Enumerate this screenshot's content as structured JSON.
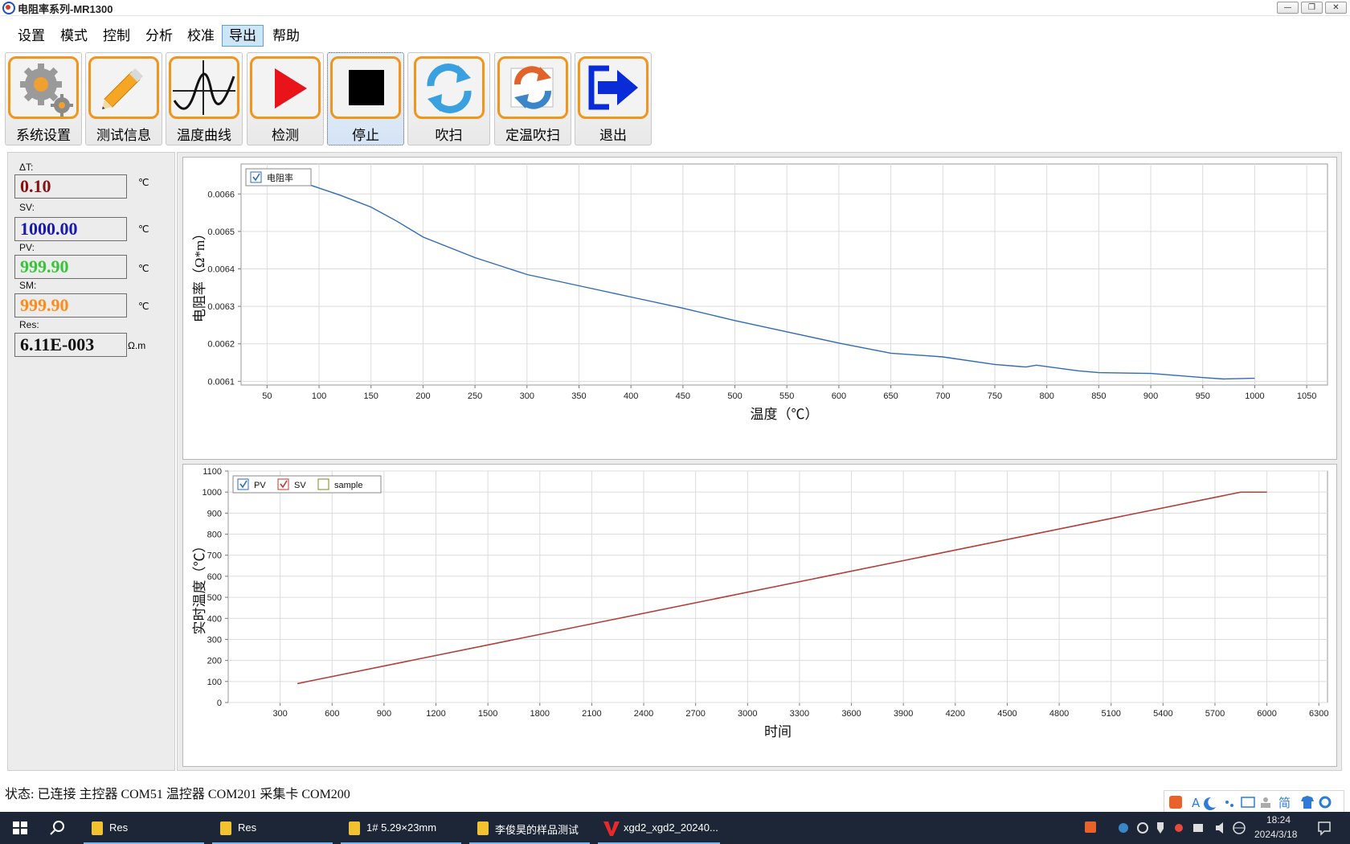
{
  "window": {
    "title": "电阻率系列-MR1300",
    "minimize": "—",
    "restore": "❐",
    "close": "✕"
  },
  "menu": [
    {
      "id": "settings",
      "label": "设置"
    },
    {
      "id": "mode",
      "label": "模式"
    },
    {
      "id": "control",
      "label": "控制"
    },
    {
      "id": "analysis",
      "label": "分析"
    },
    {
      "id": "calibrate",
      "label": "校准"
    },
    {
      "id": "export",
      "label": "导出",
      "active": true
    },
    {
      "id": "help",
      "label": "帮助"
    }
  ],
  "toolbar": [
    {
      "id": "system-settings",
      "label": "系统设置",
      "icon": "gears-icon"
    },
    {
      "id": "test-info",
      "label": "测试信息",
      "icon": "pencil-icon"
    },
    {
      "id": "temperature-curve",
      "label": "温度曲线",
      "icon": "curve-icon"
    },
    {
      "id": "detect",
      "label": "检测",
      "icon": "play-icon"
    },
    {
      "id": "stop",
      "label": "停止",
      "icon": "stop-icon",
      "selected": true
    },
    {
      "id": "sweep",
      "label": "吹扫",
      "icon": "refresh-icon"
    },
    {
      "id": "fixed-temp-sweep",
      "label": "定温吹扫",
      "icon": "cycle-icon"
    },
    {
      "id": "exit",
      "label": "退出",
      "icon": "exit-icon"
    }
  ],
  "readouts": [
    {
      "id": "delta-t",
      "label": "ΔT:",
      "value": "0.10",
      "unit": "℃",
      "color": "#8b1010"
    },
    {
      "id": "sv",
      "label": "SV:",
      "value": "1000.00",
      "unit": "℃",
      "color": "#1a1ab0"
    },
    {
      "id": "pv",
      "label": "PV:",
      "value": "999.90",
      "unit": "℃",
      "color": "#39c439"
    },
    {
      "id": "sm",
      "label": "SM:",
      "value": "999.90",
      "unit": "℃",
      "color": "#ff8c1a"
    },
    {
      "id": "res",
      "label": "Res:",
      "value": "6.11E-003",
      "unit": "Ω.m",
      "color": "#111111"
    }
  ],
  "chart_data": [
    {
      "type": "line",
      "xlabel": "温度（℃）",
      "ylabel": "电阻率（Ω*m）",
      "xlim": [
        25,
        1070
      ],
      "ylim": [
        0.00609,
        0.00668
      ],
      "xticks": [
        "50",
        "100",
        "150",
        "200",
        "250",
        "300",
        "350",
        "400",
        "450",
        "500",
        "550",
        "600",
        "650",
        "700",
        "750",
        "800",
        "850",
        "900",
        "950",
        "1000",
        "1050"
      ],
      "yticks": [
        "0.0061",
        "0.0062",
        "0.0063",
        "0.0064",
        "0.0065",
        "0.0066"
      ],
      "grid": true,
      "legend_position": "top-left",
      "series": [
        {
          "name": "电阻率",
          "color": "#2e6bb8",
          "checked": true,
          "points": [
            [
              90,
              0.006625
            ],
            [
              120,
              0.006597
            ],
            [
              150,
              0.006565
            ],
            [
              175,
              0.006527
            ],
            [
              200,
              0.006485
            ],
            [
              250,
              0.00643
            ],
            [
              300,
              0.006385
            ],
            [
              350,
              0.006355
            ],
            [
              400,
              0.006325
            ],
            [
              450,
              0.006295
            ],
            [
              500,
              0.006262
            ],
            [
              550,
              0.006232
            ],
            [
              600,
              0.006202
            ],
            [
              650,
              0.006175
            ],
            [
              700,
              0.006165
            ],
            [
              750,
              0.006145
            ],
            [
              780,
              0.006138
            ],
            [
              790,
              0.006143
            ],
            [
              830,
              0.006128
            ],
            [
              850,
              0.006123
            ],
            [
              900,
              0.006121
            ],
            [
              950,
              0.00611
            ],
            [
              970,
              0.006106
            ],
            [
              1000,
              0.006108
            ]
          ]
        }
      ]
    },
    {
      "type": "line",
      "xlabel": "时间",
      "ylabel": "实时温度（℃）",
      "xlim": [
        0,
        6350
      ],
      "ylim": [
        0,
        1100
      ],
      "xticks": [
        "300",
        "600",
        "900",
        "1200",
        "1500",
        "1800",
        "2100",
        "2400",
        "2700",
        "3000",
        "3300",
        "3600",
        "3900",
        "4200",
        "4500",
        "4800",
        "5100",
        "5400",
        "5700",
        "6000",
        "6300"
      ],
      "yticks": [
        "0",
        "100",
        "200",
        "300",
        "400",
        "500",
        "600",
        "700",
        "800",
        "900",
        "1000",
        "1100"
      ],
      "grid": true,
      "legend_position": "top-left",
      "series": [
        {
          "name": "PV",
          "color": "#2e6bb8",
          "checked": true,
          "points": [
            [
              400,
              90
            ],
            [
              5850,
              1000
            ],
            [
              6000,
              1000
            ]
          ]
        },
        {
          "name": "SV",
          "color": "#c0392b",
          "checked": true,
          "points": [
            [
              400,
              90
            ],
            [
              5850,
              1000
            ],
            [
              6000,
              1000
            ]
          ]
        },
        {
          "name": "sample",
          "color": "#7a8a20",
          "checked": false,
          "points": []
        }
      ]
    }
  ],
  "status": {
    "text": "状态:  已连接   主控器 COM51 温控器 COM201 采集卡 COM200"
  },
  "taskbar": {
    "items": [
      {
        "label": "Res"
      },
      {
        "label": "Res"
      },
      {
        "label": "1# 5.29×23mm"
      },
      {
        "label": "李俊昊的样品测试"
      },
      {
        "label": "xgd2_xgd2_20240..."
      }
    ],
    "time": "18:24",
    "date": "2024/3/18",
    "ime_lang": "简"
  }
}
